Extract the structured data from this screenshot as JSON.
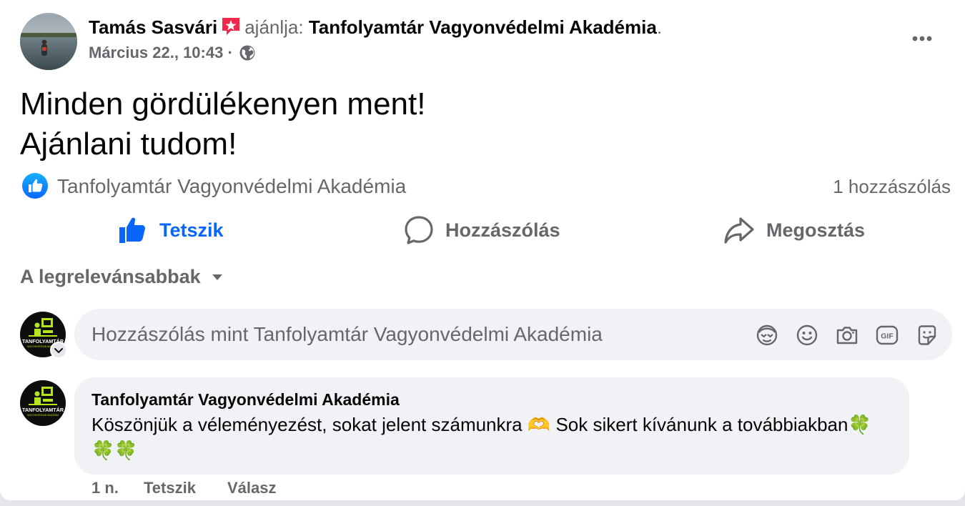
{
  "post": {
    "author": "Tamás Sasvári",
    "recommends": "ajánlja:",
    "page_name": "Tanfolyamtár Vagyonvédelmi Akadémia",
    "period": ".",
    "timestamp": "Március 22., 10:43",
    "separator": "·",
    "text": "Minden gördülékenyen ment!\nAjánlani tudom!"
  },
  "reactions": {
    "reactor": "Tanfolyamtár Vagyonvédelmi Akadémia",
    "comment_count": "1 hozzászólás"
  },
  "actions": {
    "like": "Tetszik",
    "comment": "Hozzászólás",
    "share": "Megosztás"
  },
  "sort": {
    "label": "A legrelevánsabbak"
  },
  "composer": {
    "placeholder": "Hozzászólás mint Tanfolyamtár Vagyonvédelmi Akadémia"
  },
  "page_logo": {
    "line1": "TANFOLYAMTÁR",
    "line2": "VAGYONVÉDELMI AKADÉMIA"
  },
  "comment": {
    "author": "Tanfolyamtár Vagyonvédelmi Akadémia",
    "text": "Köszönjük a véleményezést, sokat jelent számunkra 🫶 Sok sikert kívánunk a továbbiakban🍀🍀🍀",
    "age": "1 n.",
    "like": "Tetszik",
    "reply": "Válasz"
  },
  "colors": {
    "accent": "#0866ff",
    "muted": "#65676b",
    "bubble": "#f0f2f5",
    "recommend_badge": "#f02849",
    "logo_green": "#b5e61d"
  }
}
